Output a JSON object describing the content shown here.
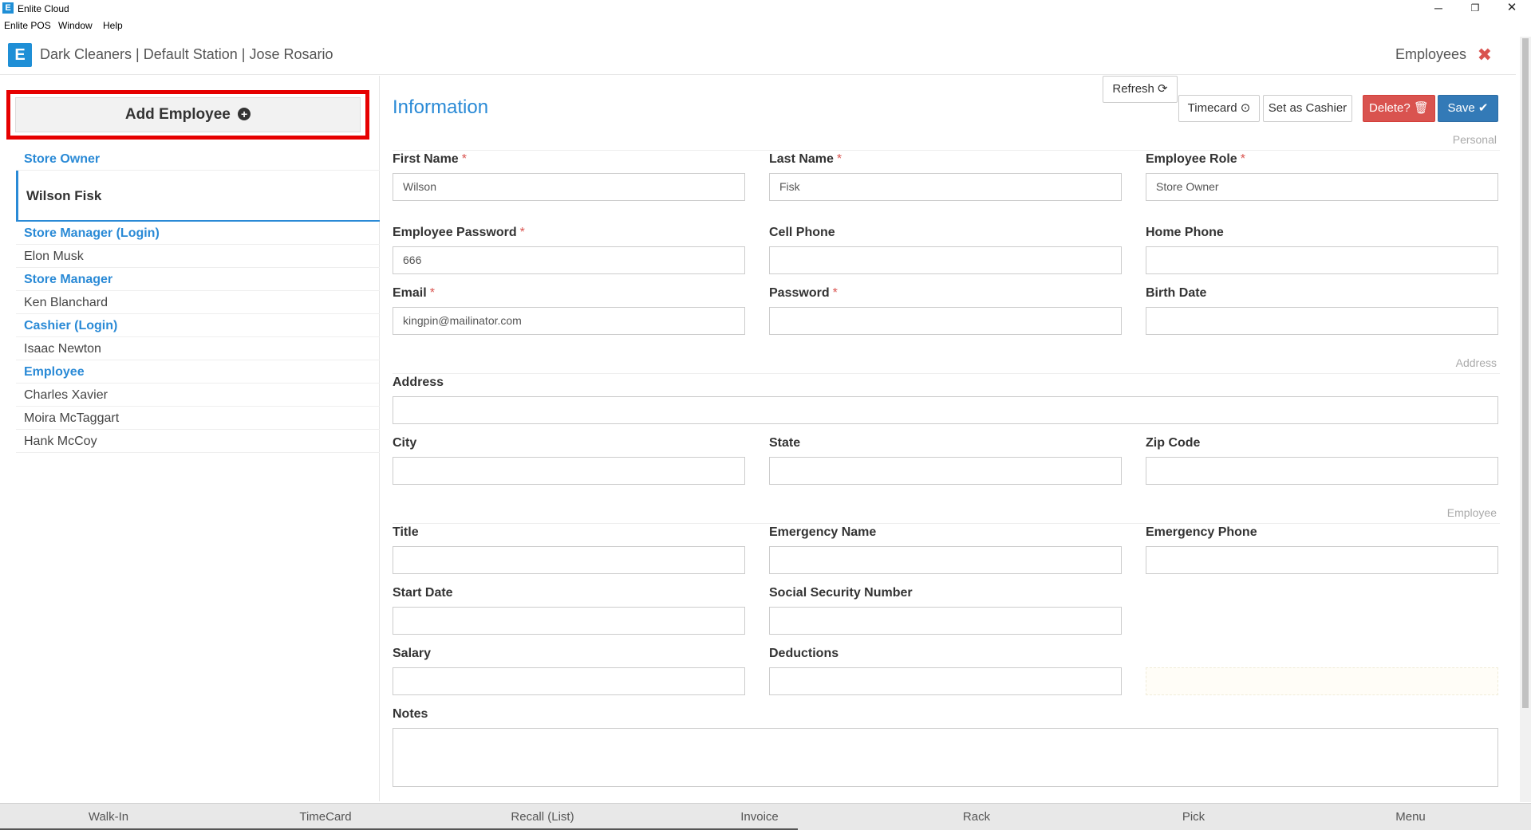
{
  "window": {
    "title": "Enlite Cloud",
    "logo_letter": "E",
    "minimize": "─",
    "maximize": "❐",
    "close": "✕"
  },
  "menubar": {
    "items": [
      "Enlite POS",
      "Window",
      "Help"
    ]
  },
  "header": {
    "logo_letter": "E",
    "breadcrumb": "Dark Cleaners | Default Station | Jose Rosario",
    "section": "Employees",
    "close_icon": "✖"
  },
  "sidebar": {
    "add_button": "Add Employee",
    "add_icon": "+",
    "groups": [
      {
        "label": "Store Owner",
        "employees": [
          "Wilson Fisk"
        ]
      },
      {
        "label": "Store Manager (Login)",
        "employees": [
          "Elon Musk"
        ]
      },
      {
        "label": "Store Manager",
        "employees": [
          "Ken Blanchard"
        ]
      },
      {
        "label": "Cashier (Login)",
        "employees": [
          "Isaac Newton"
        ]
      },
      {
        "label": "Employee",
        "employees": [
          "Charles Xavier",
          "Moira McTaggart",
          "Hank McCoy"
        ]
      }
    ],
    "selected": "Wilson Fisk"
  },
  "main": {
    "title": "Information",
    "toolbar": {
      "refresh": "Refresh ⟳",
      "timecard": "Timecard ⊙",
      "set_cashier": "Set as Cashier",
      "delete": "Delete? 🗑",
      "save": "Save ✔"
    },
    "sections": {
      "personal": "Personal",
      "address": "Address",
      "employee": "Employee"
    },
    "fields": {
      "first_name": {
        "label": "First Name",
        "value": "Wilson",
        "required": "*"
      },
      "last_name": {
        "label": "Last Name",
        "value": "Fisk",
        "required": "*"
      },
      "employee_role": {
        "label": "Employee Role",
        "value": "Store Owner",
        "required": "*"
      },
      "employee_password": {
        "label": "Employee Password",
        "value": "666",
        "required": "*"
      },
      "cell_phone": {
        "label": "Cell Phone",
        "value": ""
      },
      "home_phone": {
        "label": "Home Phone",
        "value": ""
      },
      "email": {
        "label": "Email",
        "value": "kingpin@mailinator.com",
        "required": "*"
      },
      "password": {
        "label": "Password",
        "value": "",
        "required": "*"
      },
      "birth_date": {
        "label": "Birth Date",
        "value": ""
      },
      "address": {
        "label": "Address",
        "value": ""
      },
      "city": {
        "label": "City",
        "value": ""
      },
      "state": {
        "label": "State",
        "value": ""
      },
      "zip": {
        "label": "Zip Code",
        "value": ""
      },
      "title": {
        "label": "Title",
        "value": ""
      },
      "emergency_name": {
        "label": "Emergency Name",
        "value": ""
      },
      "emergency_phone": {
        "label": "Emergency Phone",
        "value": ""
      },
      "start_date": {
        "label": "Start Date",
        "value": ""
      },
      "ssn": {
        "label": "Social Security Number",
        "value": ""
      },
      "salary": {
        "label": "Salary",
        "value": ""
      },
      "deductions": {
        "label": "Deductions",
        "value": ""
      },
      "notes": {
        "label": "Notes",
        "value": ""
      }
    }
  },
  "bottombar": {
    "items": [
      "Walk-In",
      "TimeCard",
      "Recall (List)",
      "Invoice",
      "Rack",
      "Pick",
      "Menu"
    ]
  }
}
